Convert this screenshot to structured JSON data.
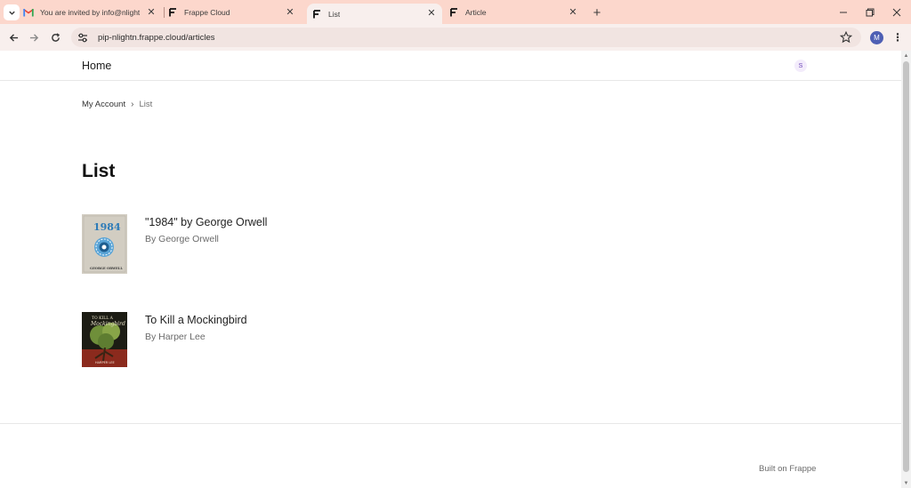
{
  "browser": {
    "tabs": [
      {
        "title": "You are invited by info@nlightn",
        "favicon": "gmail-icon",
        "active": false
      },
      {
        "title": "Frappe Cloud",
        "favicon": "frappe-icon",
        "active": false
      },
      {
        "title": "List",
        "favicon": "frappe-icon",
        "active": true
      },
      {
        "title": "Article",
        "favicon": "frappe-icon",
        "active": false
      }
    ],
    "url": "pip-nlightn.frappe.cloud/articles",
    "profile_initial": "M",
    "colors": {
      "tabbar": "#fcd7cc",
      "toolbar": "#f8efed",
      "profile": "#4e5fb4"
    }
  },
  "site": {
    "brand": "Home",
    "user_initial": "S",
    "breadcrumb": {
      "parent": "My Account",
      "current": "List"
    },
    "page_title": "List",
    "articles": [
      {
        "title": "\"1984\" by George Orwell",
        "author": "By George Orwell",
        "cover": "cover-1984",
        "cover_text": {
          "top": "1984",
          "bottom": "GEORGE ORWELL"
        }
      },
      {
        "title": "To Kill a Mockingbird",
        "author": "By Harper Lee",
        "cover": "cover-mockingbird",
        "cover_text": {
          "top": "TO KILL A",
          "middle": "Mockingbird",
          "bottom": "HARPER LEE"
        }
      }
    ],
    "footer": "Built on Frappe"
  }
}
